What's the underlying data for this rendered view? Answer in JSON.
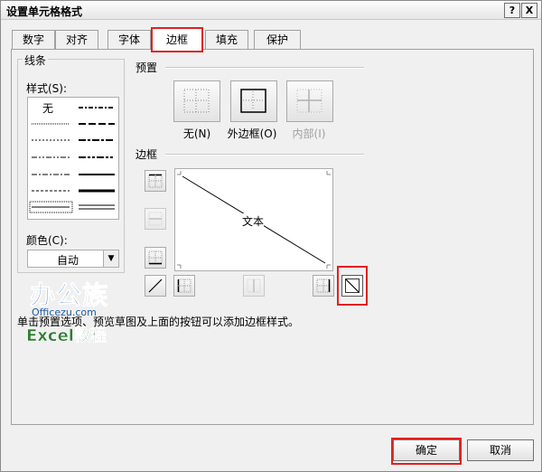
{
  "window": {
    "title": "设置单元格格式",
    "help_label": "?",
    "close_label": "X"
  },
  "tabs": [
    {
      "label": "数字"
    },
    {
      "label": "对齐"
    },
    {
      "label": "字体"
    },
    {
      "label": "边框",
      "active": true
    },
    {
      "label": "填充"
    },
    {
      "label": "保护"
    }
  ],
  "line": {
    "group_label": "线条",
    "style_label": "样式(S):",
    "none_label": "无",
    "color_label": "颜色(C):",
    "color_value": "自动"
  },
  "preset": {
    "group_label": "预置",
    "none_label": "无(N)",
    "outline_label": "外边框(O)",
    "inside_label": "内部(I)"
  },
  "border": {
    "group_label": "边框",
    "preview_text": "文本"
  },
  "hint": "单击预置选项、预览草图及上面的按钮可以添加边框样式。",
  "watermark": {
    "brand": "办公族",
    "site": "Officezu.com",
    "subtitle": "Excel教程"
  },
  "buttons": {
    "ok": "确定",
    "cancel": "取消"
  },
  "colors": {
    "highlight": "#e02020",
    "panel": "#f0f0f0",
    "logo_blue": "#1f5aa6",
    "logo_green": "#2e7d32"
  }
}
